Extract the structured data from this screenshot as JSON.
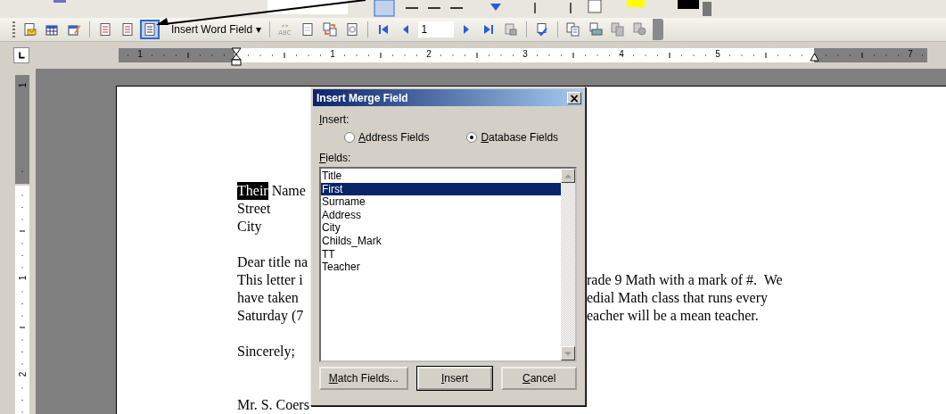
{
  "toolbar": {
    "items": [
      {
        "kind": "button",
        "selected": false
      },
      {
        "kind": "button",
        "selected": false
      },
      {
        "kind": "button",
        "selected": false
      },
      {
        "kind": "separator"
      },
      {
        "kind": "button",
        "selected": false
      },
      {
        "kind": "button",
        "selected": false
      },
      {
        "kind": "button",
        "selected": true
      },
      {
        "kind": "dropdown",
        "label": "Insert Word Field",
        "caret": "▾"
      },
      {
        "kind": "separator"
      },
      {
        "kind": "text_button",
        "label": "«»",
        "sublabel": "ABC"
      },
      {
        "kind": "button",
        "selected": false
      },
      {
        "kind": "button",
        "selected": false
      },
      {
        "kind": "button",
        "selected": false
      },
      {
        "kind": "separator"
      },
      {
        "kind": "button",
        "selected": false
      },
      {
        "kind": "button",
        "selected": false
      },
      {
        "kind": "field",
        "value": "1"
      },
      {
        "kind": "button",
        "selected": false
      },
      {
        "kind": "button",
        "selected": false
      },
      {
        "kind": "button",
        "selected": false
      },
      {
        "kind": "separator"
      },
      {
        "kind": "button",
        "selected": false
      },
      {
        "kind": "separator"
      },
      {
        "kind": "button",
        "selected": false
      },
      {
        "kind": "button",
        "selected": false
      },
      {
        "kind": "button",
        "selected": false
      },
      {
        "kind": "button",
        "selected": false
      }
    ]
  },
  "ruler": {
    "numbers": [
      "1",
      "1",
      "2",
      "3",
      "4",
      "5",
      "7"
    ]
  },
  "vertical_ruler": {
    "numbers": [
      "1",
      "1",
      "2"
    ]
  },
  "document": {
    "lines": [
      {
        "kind": "text",
        "left": [
          {
            "text": "Their",
            "selected": true
          },
          {
            "text": " Name",
            "selected": false
          }
        ]
      },
      {
        "kind": "text",
        "left": [
          {
            "text": "Street",
            "selected": false
          }
        ]
      },
      {
        "kind": "text",
        "left": [
          {
            "text": "City",
            "selected": false
          }
        ]
      },
      {
        "kind": "blank"
      },
      {
        "kind": "text",
        "left": [
          {
            "text": "Dear title na",
            "selected": false
          }
        ]
      },
      {
        "kind": "text",
        "left": [
          {
            "text": "This letter i",
            "selected": false
          }
        ],
        "right": "rade 9 Math with a mark of #.  We"
      },
      {
        "kind": "text",
        "left": [
          {
            "text": "have taken",
            "selected": false
          }
        ],
        "right": "edial Math class that runs every"
      },
      {
        "kind": "text",
        "left": [
          {
            "text": "Saturday (7",
            "selected": false
          }
        ],
        "right": "eacher will be a mean teacher."
      },
      {
        "kind": "blank"
      },
      {
        "kind": "text",
        "left": [
          {
            "text": "Sincerely;",
            "selected": false
          }
        ]
      },
      {
        "kind": "blank"
      },
      {
        "kind": "blank"
      },
      {
        "kind": "text",
        "left": [
          {
            "text": "Mr. S. Coers",
            "selected": false
          }
        ]
      }
    ]
  },
  "dialog": {
    "title": "Insert Merge Field",
    "close": "×",
    "insert_label": "Insert:",
    "options": [
      {
        "label": "Address Fields",
        "selected": false
      },
      {
        "label": "Database Fields",
        "selected": true
      }
    ],
    "fields_label": "Fields:",
    "fields": [
      {
        "label": "Title",
        "selected": false
      },
      {
        "label": "First",
        "selected": true
      },
      {
        "label": "Surname",
        "selected": false
      },
      {
        "label": "Address",
        "selected": false
      },
      {
        "label": "City",
        "selected": false
      },
      {
        "label": "Childs_Mark",
        "selected": false
      },
      {
        "label": "TT",
        "selected": false
      },
      {
        "label": "Teacher",
        "selected": false
      }
    ],
    "buttons": [
      {
        "label": "Match Fields...",
        "kind": "normal"
      },
      {
        "label": "Insert",
        "kind": "default"
      },
      {
        "label": "Cancel",
        "kind": "normal"
      }
    ]
  }
}
